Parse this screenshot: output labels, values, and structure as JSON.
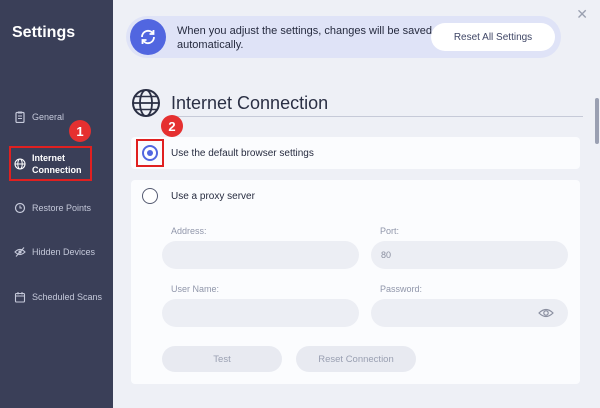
{
  "sidebar": {
    "title": "Settings",
    "items": [
      {
        "label": "General",
        "icon": "clipboard-icon"
      },
      {
        "label_line1": "Internet",
        "label_line2": "Connection",
        "icon": "globe-icon",
        "active": true
      },
      {
        "label": "Restore Points",
        "icon": "restore-icon"
      },
      {
        "label": "Hidden Devices",
        "icon": "eye-off-icon"
      },
      {
        "label": "Scheduled Scans",
        "icon": "calendar-icon"
      }
    ]
  },
  "annotations": [
    "1",
    "2"
  ],
  "banner": {
    "text": "When you adjust the settings, changes will be saved automatically.",
    "reset_all_label": "Reset All Settings"
  },
  "section": {
    "title": "Internet Connection"
  },
  "options": {
    "default_browser": "Use the default browser settings",
    "proxy": "Use a proxy server",
    "selected": "default_browser"
  },
  "proxy_form": {
    "address_label": "Address:",
    "address_value": "",
    "port_label": "Port:",
    "port_value": "80",
    "username_label": "User Name:",
    "username_value": "",
    "password_label": "Password:",
    "password_value": "",
    "test_label": "Test",
    "reset_label": "Reset Connection"
  },
  "colors": {
    "sidebar_bg": "#3a3f58",
    "accent": "#5166e0",
    "annotation": "#e02020"
  }
}
